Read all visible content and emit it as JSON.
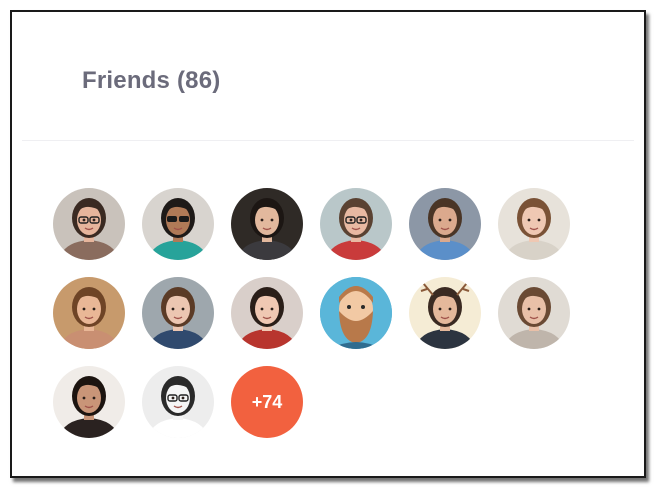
{
  "card": {
    "title": "Friends (86)"
  },
  "friends": [
    {
      "name": "friend-avatar-1",
      "bg": "#c9c2bb",
      "skin": "#e6b59c",
      "hair": "#3a2a22",
      "shirt": "#8a6c5e",
      "accessory": "glasses"
    },
    {
      "name": "friend-avatar-2",
      "bg": "#d8d4cf",
      "skin": "#b07a57",
      "hair": "#1e1a18",
      "shirt": "#27a39a",
      "accessory": "sunglasses"
    },
    {
      "name": "friend-avatar-3",
      "bg": "#2f2a26",
      "skin": "#e2b89d",
      "hair": "#1c1613",
      "shirt": "#3b3a3e",
      "accessory": "none"
    },
    {
      "name": "friend-avatar-4",
      "bg": "#b9c7c9",
      "skin": "#e8b9a2",
      "hair": "#5a4232",
      "shirt": "#c93b3b",
      "accessory": "glasses"
    },
    {
      "name": "friend-avatar-5",
      "bg": "#8c97a6",
      "skin": "#dba98d",
      "hair": "#4a3526",
      "shirt": "#5b8fc9",
      "accessory": "none"
    },
    {
      "name": "friend-avatar-6",
      "bg": "#e7e2da",
      "skin": "#efc8b3",
      "hair": "#7a5236",
      "shirt": "#d8d2c8",
      "accessory": "none"
    },
    {
      "name": "friend-avatar-7",
      "bg": "#c79a6c",
      "skin": "#e9b796",
      "hair": "#6e4426",
      "shirt": "#c98f72",
      "accessory": "none"
    },
    {
      "name": "friend-avatar-8",
      "bg": "#9ea7ad",
      "skin": "#ecc6b1",
      "hair": "#5b3b26",
      "shirt": "#304a6e",
      "accessory": "none"
    },
    {
      "name": "friend-avatar-9",
      "bg": "#d9cfca",
      "skin": "#f0c8b3",
      "hair": "#2a1e18",
      "shirt": "#b8352e",
      "accessory": "none"
    },
    {
      "name": "friend-avatar-10",
      "bg": "#5ab6d9",
      "skin": "#f2c9a4",
      "hair": "#b8794a",
      "shirt": "#2f6c8f",
      "accessory": "beard"
    },
    {
      "name": "friend-avatar-11",
      "bg": "#f5ecd5",
      "skin": "#e5b89b",
      "hair": "#3a2a22",
      "shirt": "#2c3440",
      "accessory": "antlers"
    },
    {
      "name": "friend-avatar-12",
      "bg": "#e0dbd4",
      "skin": "#e9c0a8",
      "hair": "#6a4a34",
      "shirt": "#bfb5ab",
      "accessory": "none"
    },
    {
      "name": "friend-avatar-13",
      "bg": "#f0ece8",
      "skin": "#c99578",
      "hair": "#1c1410",
      "shirt": "#2a2220",
      "accessory": "none"
    },
    {
      "name": "friend-avatar-14",
      "bg": "#ededed",
      "skin": "#f5f5f5",
      "hair": "#2a2a2a",
      "shirt": "#ffffff",
      "accessory": "sketch-glasses"
    }
  ],
  "more": {
    "label": "+74",
    "color": "#f2613f"
  }
}
